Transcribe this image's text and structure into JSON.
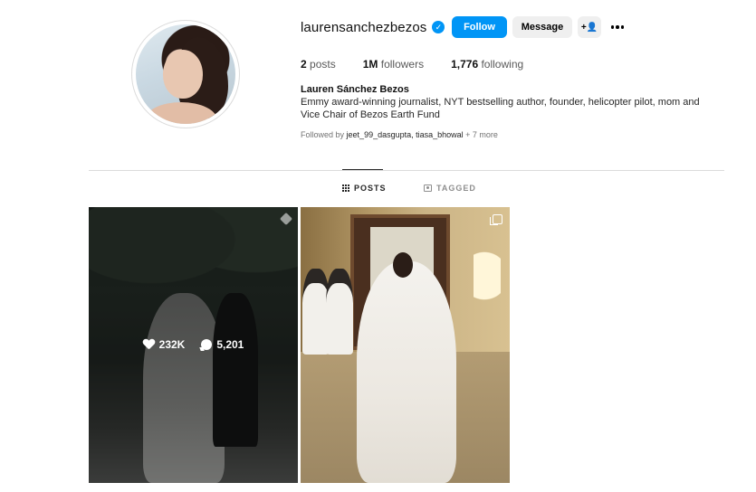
{
  "profile": {
    "username": "laurensanchezbezos",
    "verified_symbol": "✓",
    "follow_label": "Follow",
    "message_label": "Message",
    "add_user_symbol": "+👤",
    "stats": {
      "posts_count": "2",
      "posts_label": "posts",
      "followers_count": "1M",
      "followers_label": "followers",
      "following_count": "1,776",
      "following_label": "following"
    },
    "full_name": "Lauren Sánchez Bezos",
    "bio": "Emmy award-winning journalist, NYT bestselling author, founder, helicopter pilot, mom and Vice Chair of Bezos Earth Fund",
    "followed_by_prefix": "Followed by",
    "followed_by_users": "jeet_99_dasgupta, tiasa_bhowal",
    "followed_by_more": "+ 7 more"
  },
  "tabs": {
    "posts_label": "POSTS",
    "tagged_label": "TAGGED"
  },
  "posts": [
    {
      "likes": "232K",
      "comments": "5,201",
      "icon": "pin-icon"
    },
    {
      "icon": "multiple-images-icon"
    }
  ],
  "colors": {
    "accent": "#0095f6",
    "button_secondary": "#efefef",
    "muted_text": "#737373",
    "divider": "#dbdbdb"
  }
}
